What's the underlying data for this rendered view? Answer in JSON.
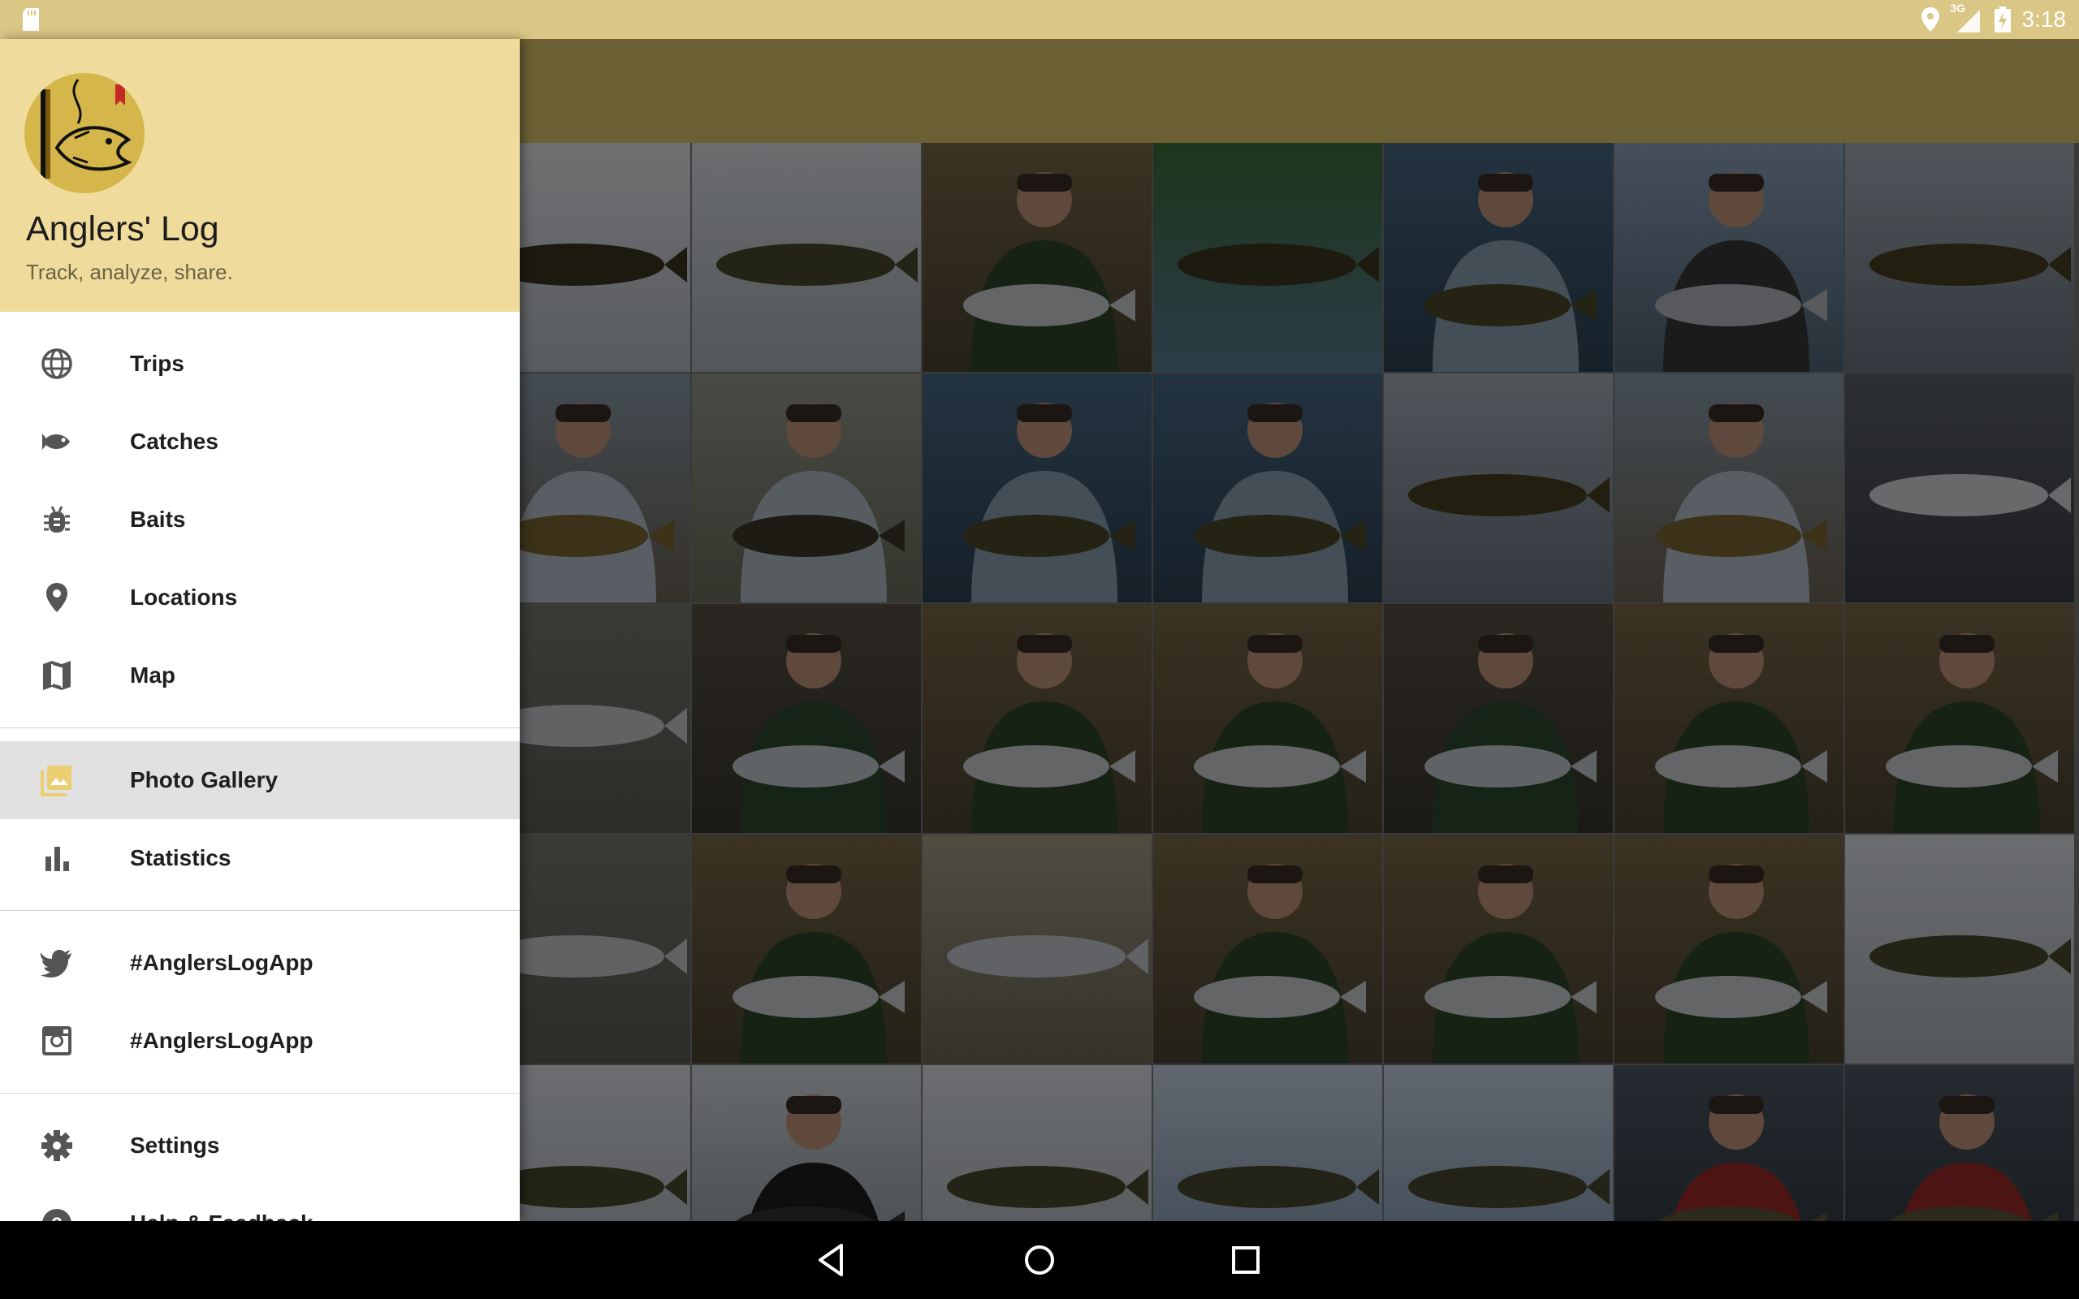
{
  "status_bar": {
    "time": "3:18",
    "network": "3G"
  },
  "drawer": {
    "app_title": "Anglers' Log",
    "app_subtitle": "Track, analyze, share.",
    "items": [
      {
        "label": "Trips",
        "icon": "globe-icon"
      },
      {
        "label": "Catches",
        "icon": "fish-icon"
      },
      {
        "label": "Baits",
        "icon": "bug-icon"
      },
      {
        "label": "Locations",
        "icon": "location-pin-icon"
      },
      {
        "label": "Map",
        "icon": "map-icon"
      },
      {
        "label": "Photo Gallery",
        "icon": "photo-library-icon",
        "active": true
      },
      {
        "label": "Statistics",
        "icon": "bar-chart-icon"
      },
      {
        "label": "#AnglersLogApp",
        "icon": "twitter-icon"
      },
      {
        "label": "#AnglersLogApp",
        "icon": "instagram-icon"
      },
      {
        "label": "Settings",
        "icon": "settings-gear-icon"
      },
      {
        "label": "Help & Feedback",
        "icon": "help-icon"
      }
    ]
  },
  "colors": {
    "status_bar": "#dac685",
    "toolbar": "#6a6033",
    "drawer_header": "#efdb9b",
    "active_item": "#e1e1e1",
    "active_icon": "#e9cf70"
  },
  "gallery": {
    "photos": [
      {
        "theme": "snow-bass"
      },
      {
        "theme": "snow-pike"
      },
      {
        "theme": "angler-trout"
      },
      {
        "theme": "lake-bass"
      },
      {
        "theme": "angler-bass"
      },
      {
        "theme": "angler-boat"
      },
      {
        "theme": "bass-closeup"
      },
      {
        "theme": "angler-shore"
      },
      {
        "theme": "water-release"
      },
      {
        "theme": "angler-bass"
      },
      {
        "theme": "angler-bass"
      },
      {
        "theme": "bass-closeup"
      },
      {
        "theme": "angler-shore"
      },
      {
        "theme": "net"
      },
      {
        "theme": "trout-closeup"
      },
      {
        "theme": "two-anglers"
      },
      {
        "theme": "angler-trout"
      },
      {
        "theme": "angler-trout"
      },
      {
        "theme": "two-anglers"
      },
      {
        "theme": "angler-trout"
      },
      {
        "theme": "angler-trout"
      },
      {
        "theme": "trout-closeup"
      },
      {
        "theme": "angler-trout"
      },
      {
        "theme": "trout-head"
      },
      {
        "theme": "angler-trout"
      },
      {
        "theme": "angler-trout"
      },
      {
        "theme": "angler-trout"
      },
      {
        "theme": "snow-pike"
      },
      {
        "theme": "snow-pike"
      },
      {
        "theme": "angler-winter"
      },
      {
        "theme": "snow-pike"
      },
      {
        "theme": "ice-pike"
      },
      {
        "theme": "ice-pike"
      },
      {
        "theme": "angler-red"
      },
      {
        "theme": "angler-red"
      }
    ]
  }
}
